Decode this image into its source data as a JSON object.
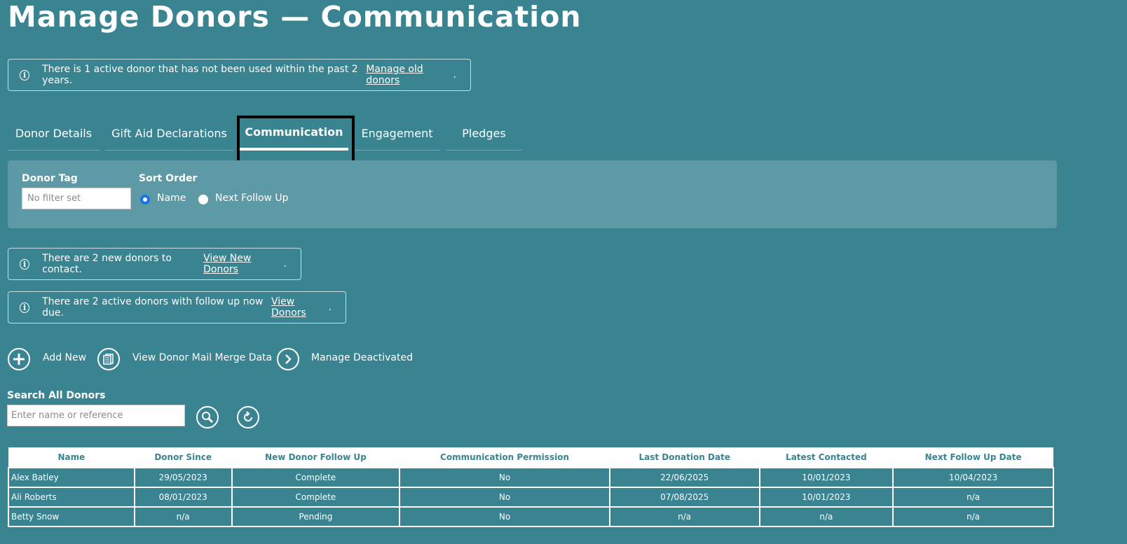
{
  "page": {
    "title": "Manage Donors — Communication"
  },
  "notices": {
    "old_donors": {
      "text": "There is 1 active donor that has not been used within the past 2 years. ",
      "link": "Manage old donors",
      "suffix": "."
    },
    "new_donors": {
      "text": "There are 2 new donors to contact. ",
      "link": "View New Donors",
      "suffix": "."
    },
    "follow_up": {
      "text": "There are 2 active donors with follow up now due. ",
      "link": "View Donors",
      "suffix": "."
    }
  },
  "tabs": [
    {
      "label": "Donor Details"
    },
    {
      "label": "Gift Aid Declarations"
    },
    {
      "label": "Communication"
    },
    {
      "label": "Engagement"
    },
    {
      "label": "Pledges"
    }
  ],
  "filters": {
    "donor_tag_label": "Donor Tag",
    "donor_tag_placeholder": "No filter set",
    "sort_order_label": "Sort Order",
    "sort_options": [
      {
        "label": "Name",
        "selected": true
      },
      {
        "label": "Next Follow Up",
        "selected": false
      }
    ]
  },
  "actions": {
    "add_new": "Add New",
    "mail_merge": "View Donor Mail Merge Data",
    "manage_deactivated": "Manage Deactivated"
  },
  "search": {
    "label": "Search All Donors",
    "placeholder": "Enter name or reference"
  },
  "table": {
    "columns": [
      "Name",
      "Donor Since",
      "New Donor Follow Up",
      "Communication Permission",
      "Last Donation Date",
      "Latest Contacted",
      "Next Follow Up Date"
    ],
    "rows": [
      [
        "Alex Batley",
        "29/05/2023",
        "Complete",
        "No",
        "22/06/2025",
        "10/01/2023",
        "10/04/2023"
      ],
      [
        "Ali Roberts",
        "08/01/2023",
        "Complete",
        "No",
        "07/08/2025",
        "10/01/2023",
        "n/a"
      ],
      [
        "Betty Snow",
        "n/a",
        "Pending",
        "No",
        "n/a",
        "n/a",
        "n/a"
      ]
    ]
  },
  "colors": {
    "background": "#3a8391",
    "panel": "#5e9aa5",
    "focus": "#000000",
    "radio_selected": "#1a73e8"
  }
}
